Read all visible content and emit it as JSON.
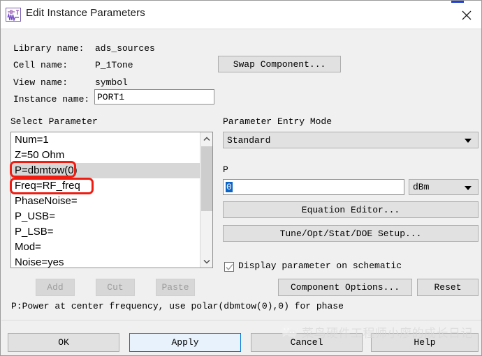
{
  "window": {
    "title": "Edit Instance Parameters",
    "icon": "component-symbol-icon",
    "close_label": "✕"
  },
  "component": {
    "library_label": "Library name:",
    "library_value": "ads_sources",
    "cell_label": "Cell name:",
    "cell_value": "P_1Tone",
    "view_label": "View name:",
    "view_value": "symbol",
    "instance_label": "Instance name:",
    "instance_value": "PORT1",
    "swap_button": "Swap Component..."
  },
  "select_parameter": {
    "heading": "Select Parameter",
    "items": [
      {
        "text": "Num=1",
        "selected": false
      },
      {
        "text": "Z=50 Ohm",
        "selected": false
      },
      {
        "text": "P=dbmtow(0)",
        "selected": true
      },
      {
        "text": "Freq=RF_freq",
        "selected": false
      },
      {
        "text": "PhaseNoise=",
        "selected": false
      },
      {
        "text": "P_USB=",
        "selected": false
      },
      {
        "text": "P_LSB=",
        "selected": false
      },
      {
        "text": "Mod=",
        "selected": false
      },
      {
        "text": "Noise=yes",
        "selected": false
      }
    ],
    "scroll_up": "˄",
    "scroll_down": "˅"
  },
  "list_actions": {
    "add": "Add",
    "cut": "Cut",
    "paste": "Paste"
  },
  "entry": {
    "heading": "Parameter Entry Mode",
    "mode_value": "Standard",
    "param_label": "P",
    "param_value": "0",
    "unit_value": "dBm",
    "equation_editor": "Equation Editor...",
    "tune_setup": "Tune/Opt/Stat/DOE Setup...",
    "display_checkbox_label": "Display parameter on schematic",
    "display_checked": true,
    "component_options": "Component Options...",
    "reset": "Reset"
  },
  "status": {
    "text": "P:Power at center frequency, use polar(dbmtow(0),0) for phase"
  },
  "footer": {
    "ok": "OK",
    "apply": "Apply",
    "cancel": "Cancel",
    "help": "Help"
  },
  "watermark": {
    "text": "菜鸟硬件工程师小廖的成长日记"
  },
  "colors": {
    "accent": "#0078d7",
    "annotation": "#f01c12",
    "dialog_bg": "#f0f0f0",
    "selection": "#d7d7d7",
    "text_selection": "#0a64c8"
  }
}
